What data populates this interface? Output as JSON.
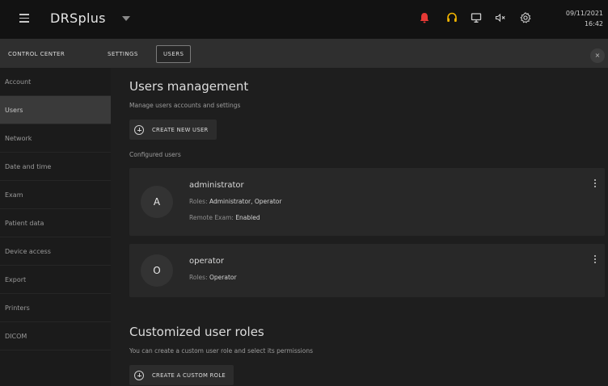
{
  "app": {
    "title": "DRSplus"
  },
  "header": {
    "icons": [
      "menu-icon",
      "bell-icon",
      "headset-icon",
      "monitor-icon",
      "volume-mute-icon",
      "gear-icon"
    ],
    "date": "09/11/2021",
    "time": "16:42",
    "alert_color": "#e53935",
    "support_color": "#f2b400"
  },
  "tabs": [
    {
      "label": "CONTROL CENTER"
    },
    {
      "label": "SETTINGS"
    },
    {
      "label": "USERS",
      "active": true
    }
  ],
  "close_label": "×",
  "sidebar": {
    "items": [
      {
        "label": "Account"
      },
      {
        "label": "Users",
        "active": true
      },
      {
        "label": "Network"
      },
      {
        "label": "Date and time"
      },
      {
        "label": "Exam"
      },
      {
        "label": "Patient data"
      },
      {
        "label": "Device access"
      },
      {
        "label": "Export"
      },
      {
        "label": "Printers"
      },
      {
        "label": "DICOM"
      }
    ]
  },
  "main": {
    "users": {
      "title": "Users management",
      "subtitle": "Manage users accounts and settings",
      "create_button": "CREATE NEW USER",
      "configured_label": "Configured users",
      "list": [
        {
          "initial": "A",
          "name": "administrator",
          "roles_label": "Roles: ",
          "roles_value": "Administrator, Operator",
          "remote_label": "Remote Exam: ",
          "remote_value": "Enabled"
        },
        {
          "initial": "O",
          "name": "operator",
          "roles_label": "Roles: ",
          "roles_value": "Operator"
        }
      ]
    },
    "roles": {
      "title": "Customized user roles",
      "subtitle": "You can create a custom user role and select its permissions",
      "create_button": "CREATE A CUSTOM ROLE"
    }
  }
}
